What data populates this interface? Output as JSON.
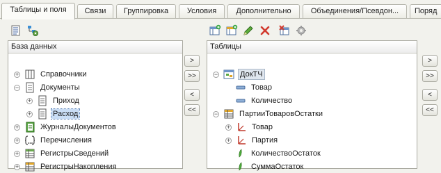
{
  "tabs": [
    {
      "label": "Таблицы и поля"
    },
    {
      "label": "Связи"
    },
    {
      "label": "Группировка"
    },
    {
      "label": "Условия"
    },
    {
      "label": "Дополнительно"
    },
    {
      "label": "Объединения/Псевдон..."
    },
    {
      "label": "Поряд"
    }
  ],
  "left_panel": {
    "title": "База данных",
    "items": [
      {
        "label": "Справочники"
      },
      {
        "label": "Документы"
      },
      {
        "label": "Приход"
      },
      {
        "label": "Расход"
      },
      {
        "label": "ЖурналыДокументов"
      },
      {
        "label": "Перечисления"
      },
      {
        "label": "РегистрыСведений"
      },
      {
        "label": "РегистрыНакопления"
      }
    ]
  },
  "right_panel": {
    "title": "Таблицы",
    "items": [
      {
        "label": "ДокТЧ"
      },
      {
        "label": "Товар"
      },
      {
        "label": "Количество"
      },
      {
        "label": "ПартииТоваровОстатки"
      },
      {
        "label": "Товар"
      },
      {
        "label": "Партия"
      },
      {
        "label": "КоличествоОстаток"
      },
      {
        "label": "СуммаОстаток"
      }
    ]
  },
  "buttons": {
    "move_right": ">",
    "move_all_right": ">>",
    "move_left": "<",
    "move_all_left": "<<"
  },
  "colors": {
    "accent": "#c9ddf5",
    "delete_red": "#d23b2f",
    "edit_green": "#3a9b2d"
  }
}
